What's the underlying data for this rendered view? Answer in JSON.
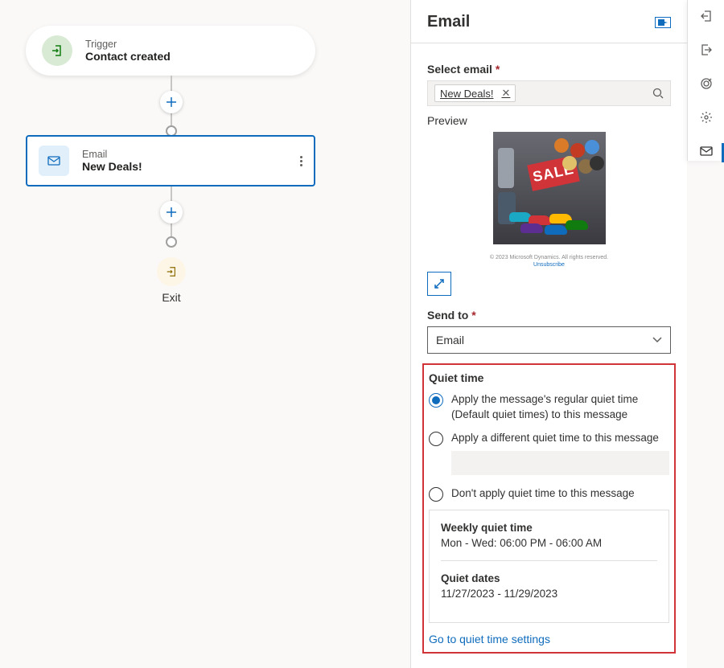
{
  "canvas": {
    "trigger": {
      "label": "Trigger",
      "name": "Contact created"
    },
    "email": {
      "label": "Email",
      "name": "New Deals!"
    },
    "exit": {
      "label": "Exit"
    }
  },
  "panel": {
    "title": "Email",
    "select_email_label": "Select email",
    "selected_email": "New Deals!",
    "preview_label": "Preview",
    "preview_sale_text": "SALE",
    "preview_caption_1": "© 2023 Microsoft Dynamics. All rights reserved.",
    "preview_caption_2": "Unsubscribe",
    "send_to_label": "Send to",
    "send_to_value": "Email",
    "quiet_time": {
      "header": "Quiet time",
      "opt1": "Apply the message's regular quiet time (Default quiet times) to this message",
      "opt2": "Apply a different quiet time to this message",
      "opt3": "Don't apply quiet time to this message",
      "weekly_title": "Weekly quiet time",
      "weekly_value": "Mon - Wed: 06:00 PM - 06:00 AM",
      "dates_title": "Quiet dates",
      "dates_value": "11/27/2023 - 11/29/2023",
      "link": "Go to quiet time settings"
    }
  },
  "required_mark": "*"
}
